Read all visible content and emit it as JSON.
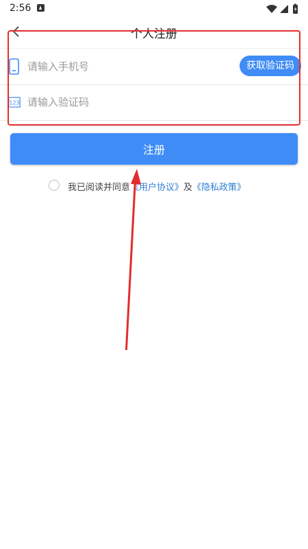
{
  "status_bar": {
    "time": "2:56"
  },
  "header": {
    "title": "个人注册"
  },
  "form": {
    "phone_placeholder": "请输入手机号",
    "code_placeholder": "请输入验证码",
    "get_code_label": "获取验证码",
    "code_icon_text": "123"
  },
  "register_label": "注册",
  "agreement": {
    "prefix": "我已阅读并同意",
    "user_agreement": "《用户协议》",
    "joiner": "及",
    "privacy_policy": "《隐私政策》"
  },
  "colors": {
    "accent": "#3f8cf7",
    "link": "#2f7fd3",
    "annotation": "#e32b2b"
  },
  "icons": [
    "back-icon",
    "phone-icon",
    "code-icon",
    "wifi-icon",
    "signal-icon",
    "battery-icon"
  ]
}
